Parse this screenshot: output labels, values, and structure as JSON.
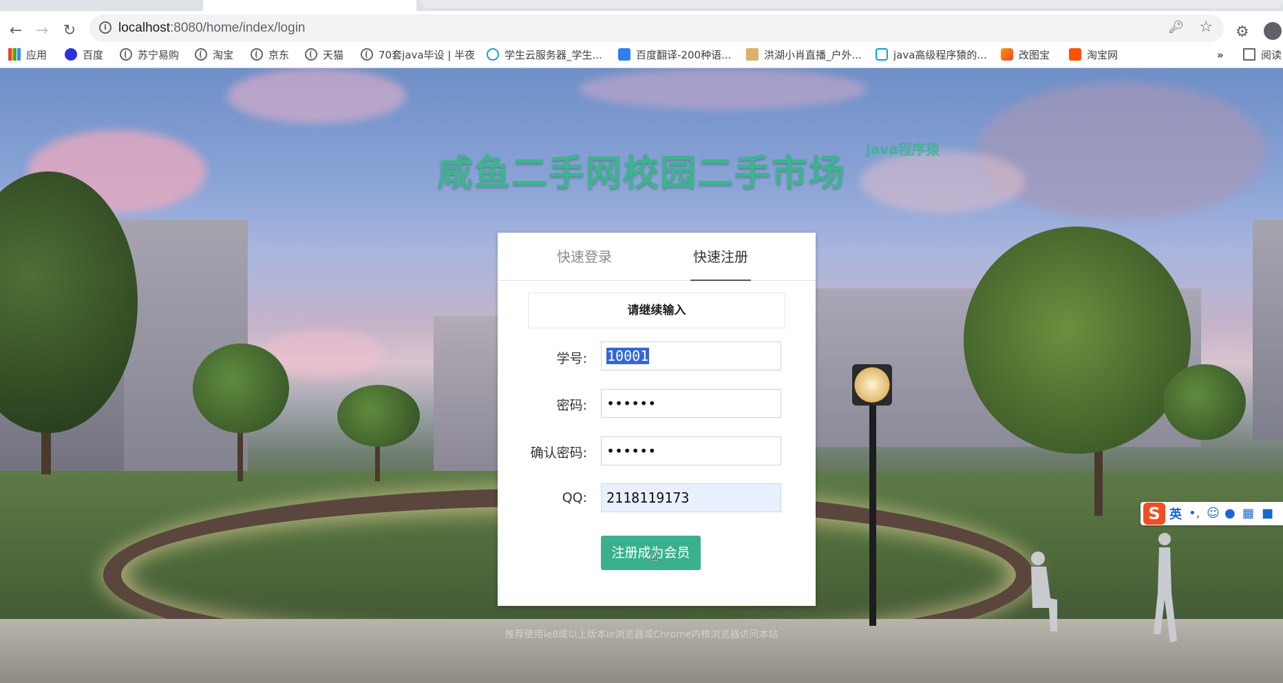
{
  "browser": {
    "url_host": "localhost",
    "url_rest": ":8080/home/index/login",
    "bookmarks": [
      {
        "label": "应用",
        "icon": "apps-grid-icon"
      },
      {
        "label": "百度",
        "icon": "baidu-paw-icon"
      },
      {
        "label": "苏宁易购",
        "icon": "globe-icon"
      },
      {
        "label": "淘宝",
        "icon": "globe-icon"
      },
      {
        "label": "京东",
        "icon": "globe-icon"
      },
      {
        "label": "天猫",
        "icon": "globe-icon"
      },
      {
        "label": "70套java毕设 | 半夜",
        "icon": "globe-icon"
      },
      {
        "label": "学生云服务器_学生...",
        "icon": "cloud-icon"
      },
      {
        "label": "百度翻译-200种语...",
        "icon": "translate-icon"
      },
      {
        "label": "洪湖小肖直播_户外...",
        "icon": "feather-icon"
      },
      {
        "label": "java高级程序猿的...",
        "icon": "bilibili-icon"
      },
      {
        "label": "改图宝",
        "icon": "orange-square-icon"
      },
      {
        "label": "淘宝网",
        "icon": "taobao-icon"
      }
    ],
    "reading_list": "阅读"
  },
  "page": {
    "title": "咸鱼二手网校园二手市场",
    "subtitle": "java程序猿",
    "tabs": [
      "快速登录",
      "快速注册"
    ],
    "active_tab": 1,
    "notice": "请继续输入",
    "form": {
      "student_id_label": "学号:",
      "student_id_value": "10001",
      "password_label": "密码:",
      "password_value": "••••••",
      "confirm_label": "确认密码:",
      "confirm_value": "••••••",
      "qq_label": "QQ:",
      "qq_value": "2118119173",
      "submit_label": "注册成为会员"
    },
    "footer": "推荐使用ie8或以上版本ie浏览器或Chrome内核浏览器访问本站"
  },
  "ime": {
    "logo": "S",
    "lang": "英"
  },
  "colors": {
    "accent": "#3bb08f",
    "title": "#3db38e"
  }
}
